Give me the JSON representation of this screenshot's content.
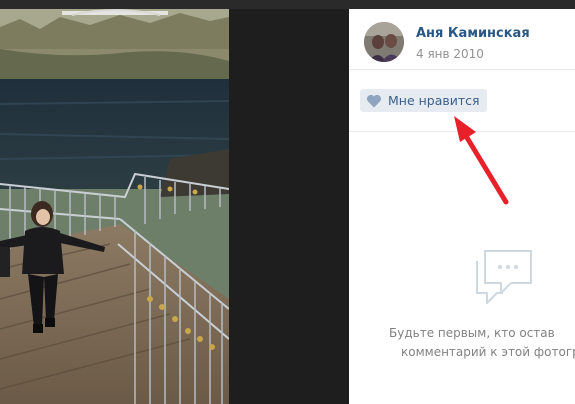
{
  "post": {
    "author_name": "Аня Каминская",
    "date": "4 янв 2010"
  },
  "like": {
    "label": "Мне нравится",
    "icon": "heart-icon"
  },
  "comments": {
    "icon": "comment-bubble-icon",
    "empty_line1": "Будьте первым, кто остав",
    "empty_line2": "комментарий к этой фотогра"
  },
  "colors": {
    "author_link": "#2a5885",
    "like_bg": "#e5ebf1",
    "annotation_arrow": "#e8202a"
  }
}
